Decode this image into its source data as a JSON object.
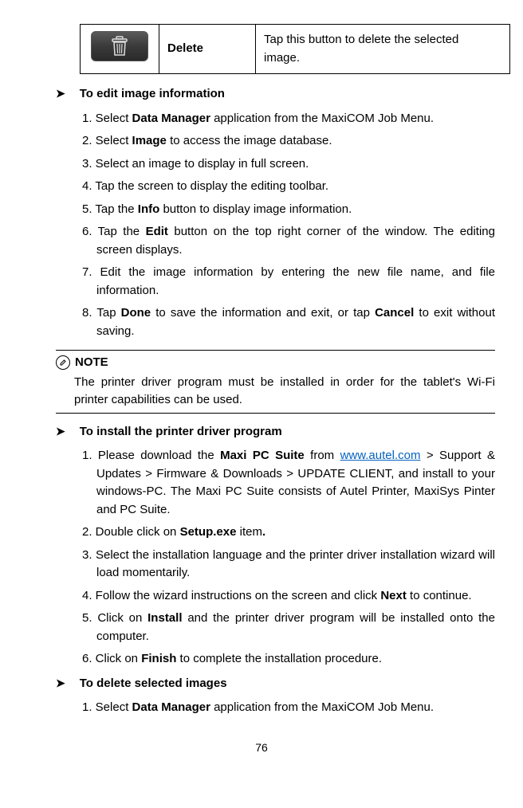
{
  "table": {
    "label": "Delete",
    "desc_a": "Tap this button to delete the selected",
    "desc_b": "image."
  },
  "s1": {
    "title": "To edit image information",
    "step1_a": "1. Select ",
    "step1_b": "Data Manager",
    "step1_c": " application from the MaxiCOM Job Menu.",
    "step2_a": "2. Select ",
    "step2_b": "Image",
    "step2_c": " to access the image database.",
    "step3": "3. Select an image to display in full screen.",
    "step4": "4. Tap the screen to display the editing toolbar.",
    "step5_a": "5. Tap the ",
    "step5_b": "Info",
    "step5_c": " button to display image information.",
    "step6_a": "6. Tap the ",
    "step6_b": "Edit",
    "step6_c": " button on the top right corner of the window. The editing screen displays.",
    "step7": "7. Edit the image information by entering the new file name, and file information.",
    "step8_a": "8. Tap ",
    "step8_b": "Done",
    "step8_c": " to save the information and exit, or tap ",
    "step8_d": "Cancel",
    "step8_e": " to exit without saving."
  },
  "note": {
    "head": "NOTE",
    "body": "The printer driver program must be installed in order for the tablet's Wi-Fi printer capabilities can be used."
  },
  "s2": {
    "title": "To install the printer driver program",
    "step1_a": "1. Please download the ",
    "step1_b": "Maxi PC Suite",
    "step1_c": " from ",
    "step1_link": "www.autel.com",
    "step1_d": " > Support & Updates > Firmware & Downloads > UPDATE CLIENT, and install to your windows-PC. The Maxi PC Suite consists of Autel Printer, MaxiSys Pinter and PC Suite.",
    "step2_a": "2. Double click on ",
    "step2_b": "Setup.exe",
    "step2_c": " item",
    "step2_d": ".",
    "step3": "3. Select the installation language and the printer driver installation wizard will load momentarily.",
    "step4_a": "4. Follow the wizard instructions on the screen and click ",
    "step4_b": "Next",
    "step4_c": " to continue.",
    "step5_a": "5. Click on ",
    "step5_b": "Install",
    "step5_c": " and the printer driver program will be installed onto the computer.",
    "step6_a": "6. Click on ",
    "step6_b": "Finish",
    "step6_c": " to complete the installation procedure."
  },
  "s3": {
    "title": "To delete selected images",
    "step1_a": "1. Select ",
    "step1_b": "Data Manager",
    "step1_c": " application from the MaxiCOM Job Menu."
  },
  "page": "76"
}
